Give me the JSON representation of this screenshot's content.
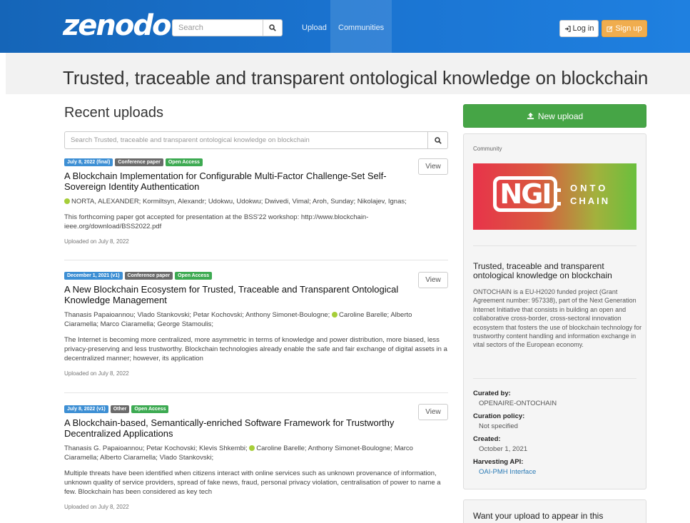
{
  "nav": {
    "logo": "zenodo",
    "search_placeholder": "Search",
    "links": [
      {
        "label": "Upload"
      },
      {
        "label": "Communities"
      }
    ],
    "login_label": "Log in",
    "signup_label": "Sign up"
  },
  "header": {
    "title": "Trusted, traceable and transparent ontological knowledge on blockchain"
  },
  "recent": {
    "title": "Recent uploads",
    "search_placeholder": "Search Trusted, traceable and transparent ontological knowledge on blockchain",
    "view_label": "View",
    "records": [
      {
        "badges": [
          "July 8, 2022 (final)",
          "Conference paper",
          "Open Access"
        ],
        "title": "A Blockchain Implementation for Configurable Multi-Factor Challenge-Set Self-Sovereign Identity Authentication",
        "authors": "NORTA, ALEXANDER; Kormiltsyn, Alexandr; Udokwu, Udokwu; Dwivedi, Vimal; Aroh, Sunday; Nikolajev, Ignas;",
        "description": "This forthcoming paper got accepted for presentation at the BSS'22 workshop: http://www.blockchain-ieee.org/download/BSS2022.pdf",
        "uploaded": "Uploaded on July 8, 2022"
      },
      {
        "badges": [
          "December 1, 2021 (v1)",
          "Conference paper",
          "Open Access"
        ],
        "title": "A New Blockchain Ecosystem for Trusted, Traceable and Transparent Ontological Knowledge Management",
        "authors_before": "Thanasis Papaioannou; Vlado Stankovski; Petar Kochovski; Anthony Simonet-Boulogne;",
        "authors_after": "Caroline Barelle; Alberto Ciaramella; Marco Ciaramella; George Stamoulis;",
        "description": "The Internet is becoming more centralized, more asymmetric in terms of knowledge and power distribution, more biased, less privacy-preserving and less trustworthy. Blockchain technologies already enable the safe and fair exchange of digital assets in a decentralized manner; however, its application",
        "uploaded": "Uploaded on July 8, 2022"
      },
      {
        "badges": [
          "July 8, 2022 (v1)",
          "Other",
          "Open Access"
        ],
        "title": "A Blockchain-based, Semantically-enriched Software Framework for Trustworthy Decentralized Applications",
        "authors_before": "Thanasis G. Papaioannou; Petar Kochovski; Klevis Shkembi;",
        "authors_after": "Caroline Barelle; Anthony Simonet-Boulogne; Marco Ciaramella; Alberto Ciaramella; Vlado Stankovski;",
        "description": "Multiple threats have been identified when citizens interact with online services such as unknown provenance of information, unknown quality of service providers, spread of fake news, fraud, personal privacy violation, centralisation of power to name a few. Blockchain has been considered as key tech",
        "uploaded": "Uploaded on July 8, 2022"
      }
    ]
  },
  "sidebar": {
    "new_upload_label": "New upload",
    "community_label": "Community",
    "logo_letters": "NGI",
    "logo_line1": "ONTO",
    "logo_line2": "CHAIN",
    "community_title": "Trusted, traceable and transparent ontological knowledge on blockchain",
    "community_desc": "ONTOCHAIN is a EU-H2020 funded project (Grant Agreement number: 957338), part of the Next Generation Internet Initiative that consists in building an open and collaborative cross-border, cross-sectoral innovation ecosystem that fosters the use of blockchain technology for trustworthy content handling and information exchange in vital sectors of the European economy.",
    "meta": {
      "curated_by_label": "Curated by:",
      "curated_by": "OPENAIRE-ONTOCHAIN",
      "policy_label": "Curation policy:",
      "policy": "Not specified",
      "created_label": "Created:",
      "created": "October 1, 2021",
      "harvest_label": "Harvesting API:",
      "harvest": "OAI-PMH Interface"
    },
    "panel2_text": "Want your upload to appear in this"
  },
  "colors": {
    "navbar": "#1a73d0",
    "signup": "#f0ad4e",
    "new_upload": "#46a546",
    "badge_blue": "#3d8fd4",
    "badge_grey": "#6b6b6b",
    "badge_green": "#3daa52"
  }
}
